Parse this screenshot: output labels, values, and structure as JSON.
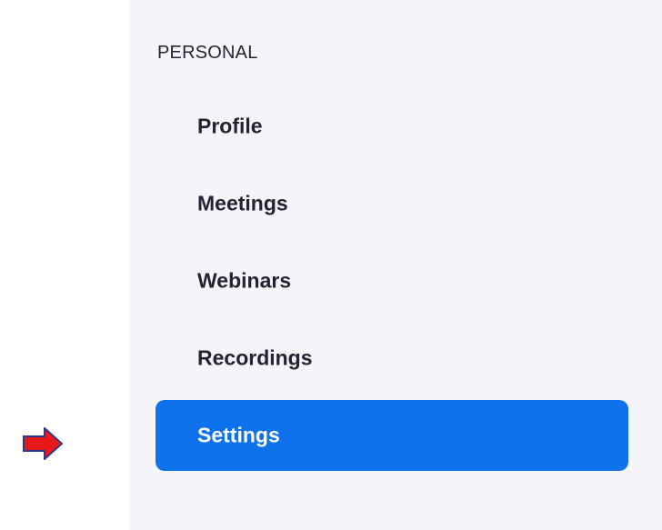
{
  "sidebar": {
    "section_label": "PERSONAL",
    "items": [
      {
        "label": "Profile",
        "active": false
      },
      {
        "label": "Meetings",
        "active": false
      },
      {
        "label": "Webinars",
        "active": false
      },
      {
        "label": "Recordings",
        "active": false
      },
      {
        "label": "Settings",
        "active": true
      }
    ]
  },
  "annotation": {
    "icon": "right-arrow-icon",
    "fill_color": "#e8191b",
    "stroke_color": "#2b3a8f"
  },
  "colors": {
    "sidebar_background": "#f4f4f9",
    "active_background": "#0e72ed",
    "text": "#232333",
    "active_text": "#ffffff"
  }
}
